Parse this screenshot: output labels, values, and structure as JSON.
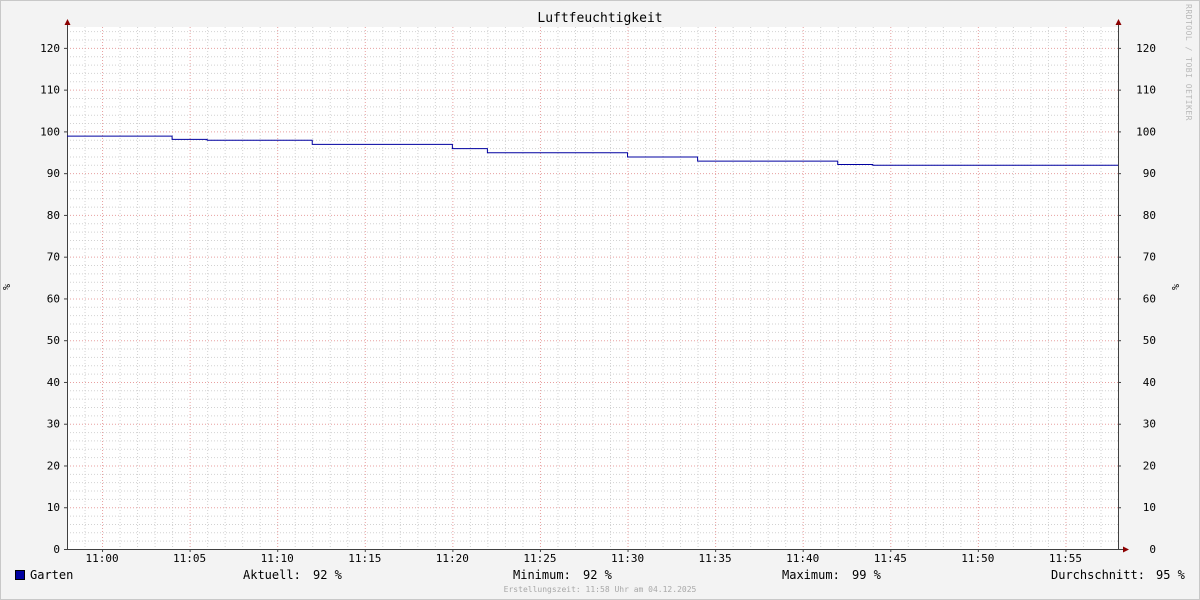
{
  "title": "Luftfeuchtigkeit",
  "watermark": "RRDTOOL / TOBI OETIKER",
  "footer": "Erstellungszeit: 11:58 Uhr am 04.12.2025",
  "legend": {
    "series_name": "Garten",
    "aktuell_label": "Aktuell:",
    "aktuell_value": "92 %",
    "minimum_label": "Minimum:",
    "minimum_value": "92 %",
    "maximum_label": "Maximum:",
    "maximum_value": "99 %",
    "durchschnitt_label": "Durchschnitt:",
    "durchschnitt_value": "95 %"
  },
  "colors": {
    "series": "#0000a0",
    "major_grid": "#e8a0a0",
    "minor_grid": "#d2d2d2",
    "axis": "#404040",
    "arrow": "#8b0000",
    "plot_background": "#ffffff"
  },
  "chart_data": {
    "type": "line",
    "title": "Luftfeuchtigkeit",
    "xlabel": "",
    "ylabel": "%",
    "ylabel_right": "%",
    "x_range": [
      "10:58",
      "11:58"
    ],
    "ylim": [
      0,
      125
    ],
    "y_ticks": [
      0,
      10,
      20,
      30,
      40,
      50,
      60,
      70,
      80,
      90,
      100,
      110,
      120
    ],
    "x_ticks": [
      "11:00",
      "11:05",
      "11:10",
      "11:15",
      "11:20",
      "11:25",
      "11:30",
      "11:35",
      "11:40",
      "11:45",
      "11:50",
      "11:55"
    ],
    "grid": true,
    "legend_position": "bottom",
    "series": [
      {
        "name": "Garten",
        "color": "#0000a0",
        "step": true,
        "points": [
          {
            "x": "10:58",
            "y": 99
          },
          {
            "x": "11:04",
            "y": 98.2
          },
          {
            "x": "11:06",
            "y": 98
          },
          {
            "x": "11:12",
            "y": 97
          },
          {
            "x": "11:20",
            "y": 96
          },
          {
            "x": "11:22",
            "y": 95
          },
          {
            "x": "11:30",
            "y": 94
          },
          {
            "x": "11:34",
            "y": 93
          },
          {
            "x": "11:42",
            "y": 92.2
          },
          {
            "x": "11:44",
            "y": 92
          },
          {
            "x": "11:58",
            "y": 92
          }
        ]
      }
    ]
  }
}
